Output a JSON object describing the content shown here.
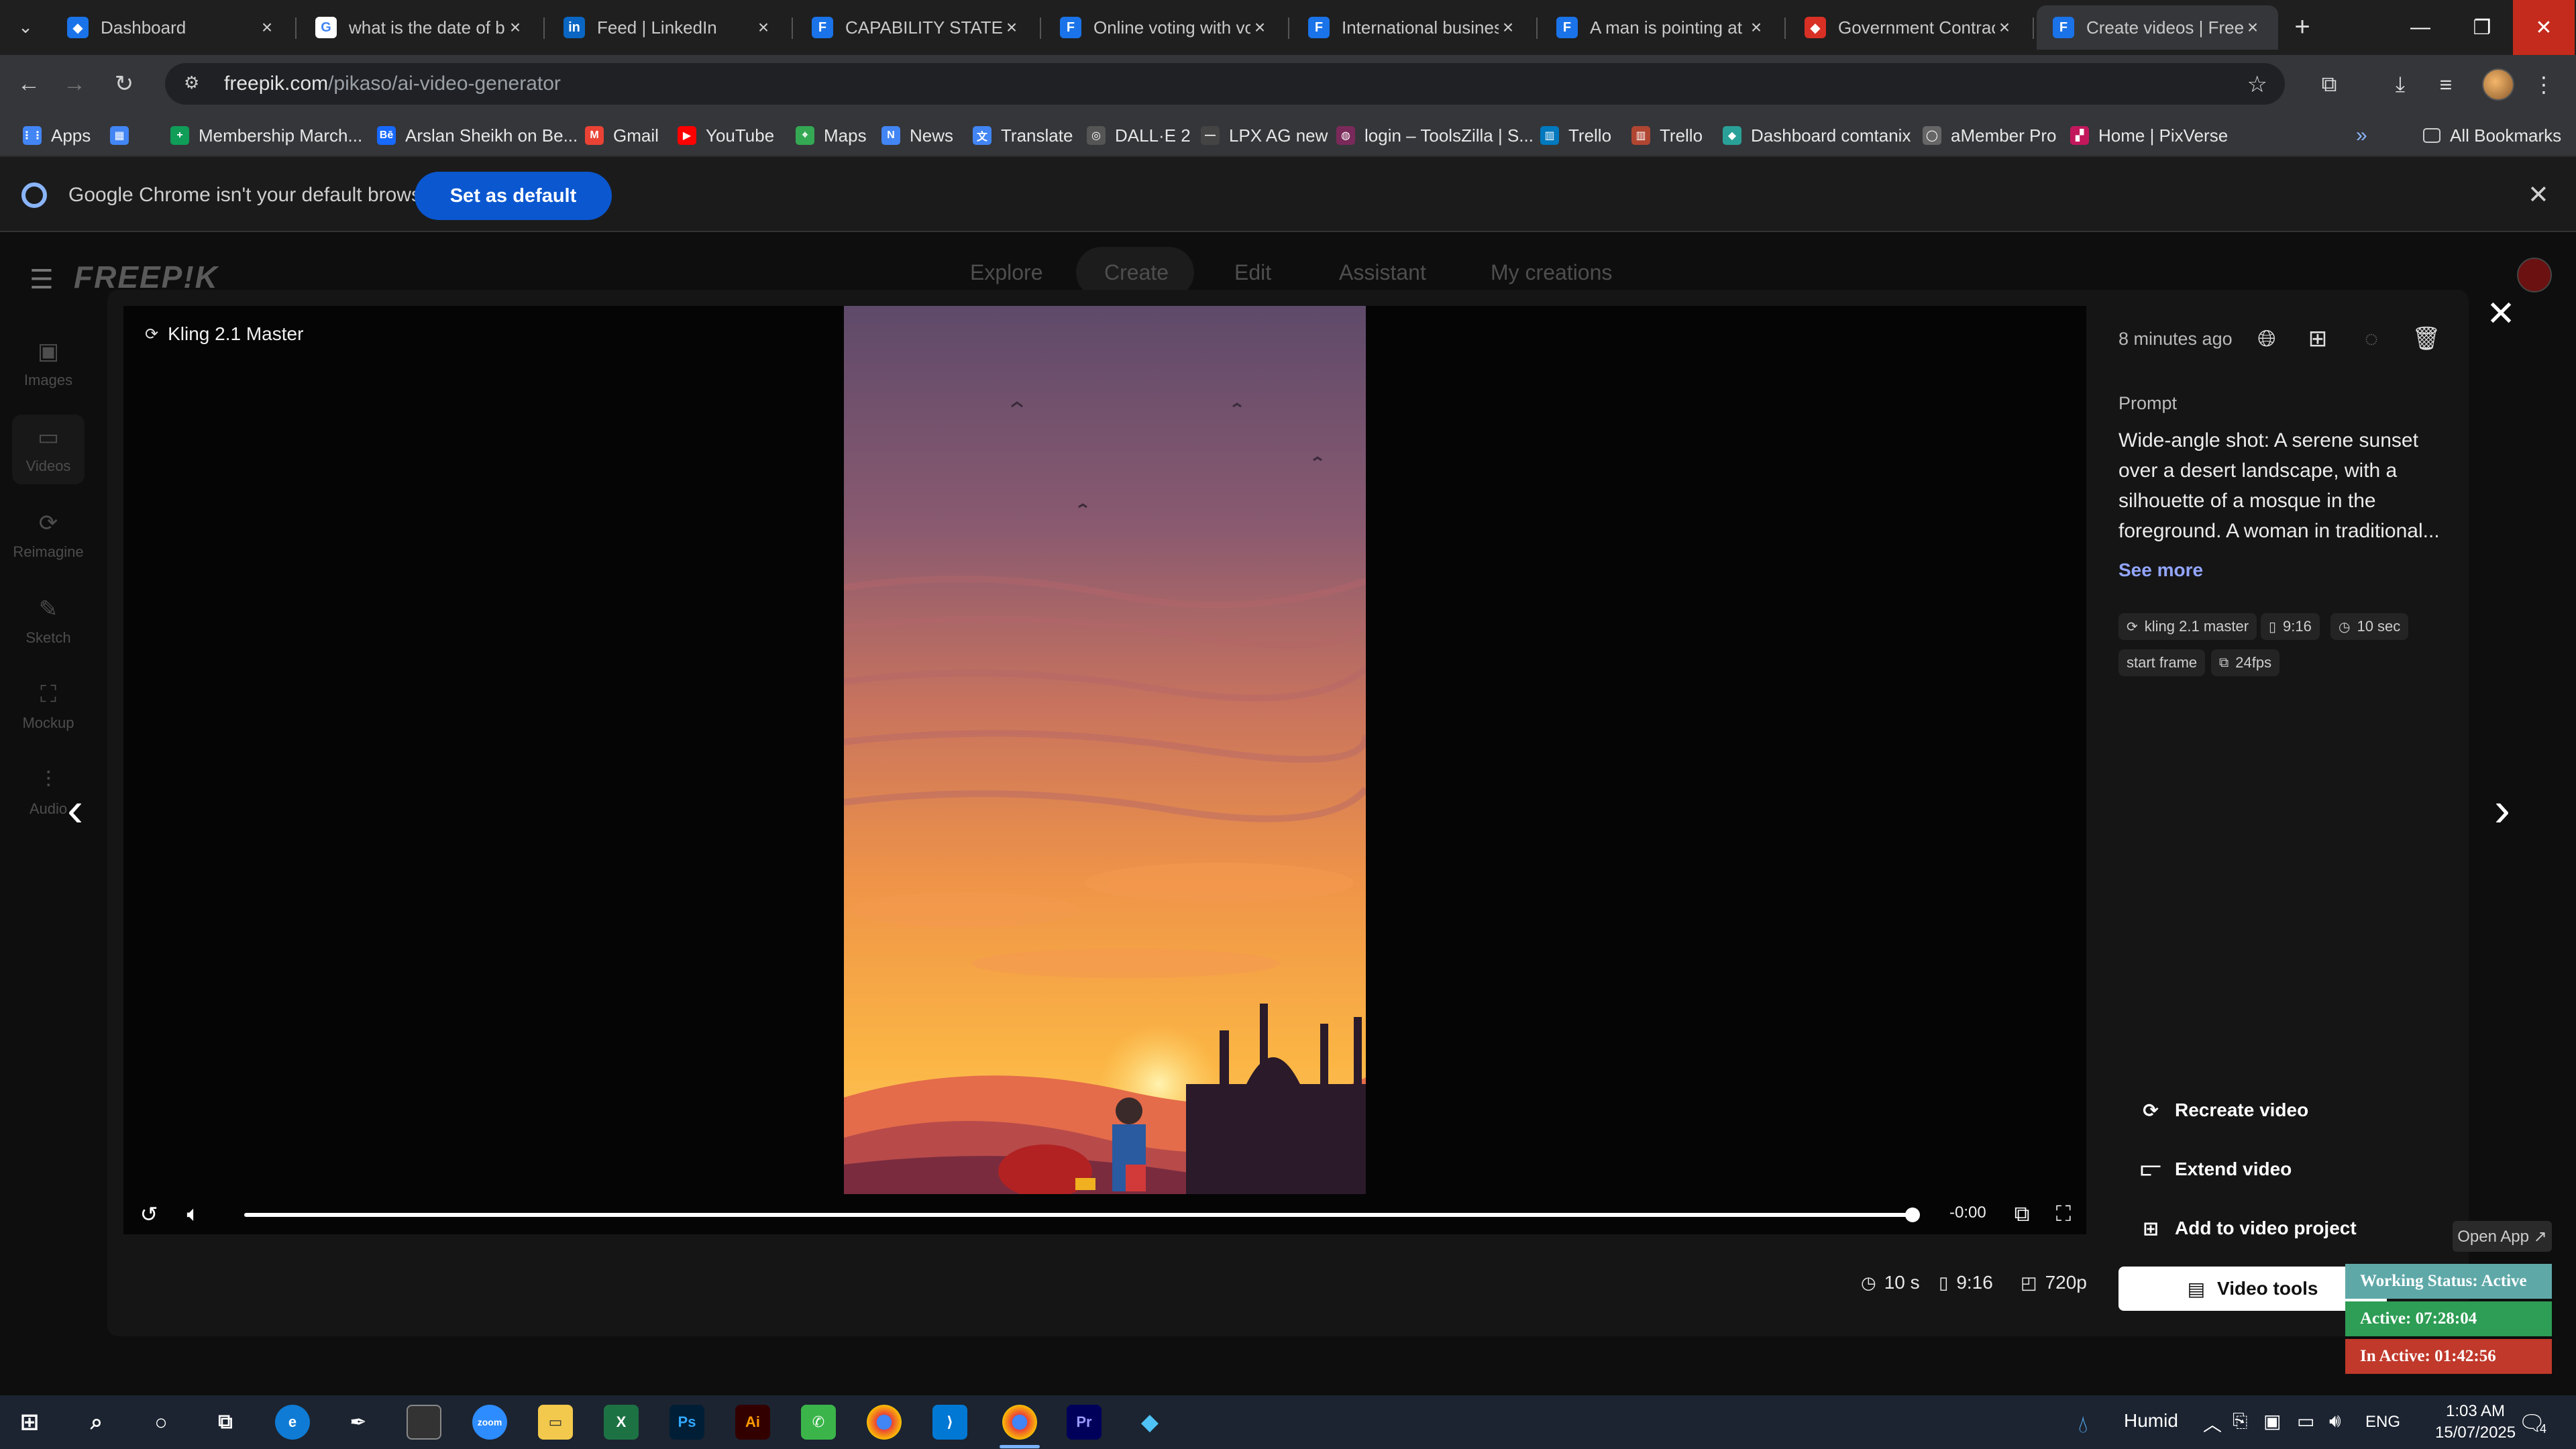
{
  "browser": {
    "tabs": [
      {
        "title": "Dashboard",
        "active": false,
        "color": "#1a73e8",
        "glyph": "◆"
      },
      {
        "title": "what is the date of bi",
        "active": false,
        "color": "#ffffff",
        "glyph": "G"
      },
      {
        "title": "Feed | LinkedIn",
        "active": false,
        "color": "#0a66c2",
        "glyph": "in"
      },
      {
        "title": "CAPABILITY STATEME",
        "active": false,
        "color": "#1a73e8",
        "glyph": "F"
      },
      {
        "title": "Online voting with vo",
        "active": false,
        "color": "#1a73e8",
        "glyph": "F"
      },
      {
        "title": "International busines",
        "active": false,
        "color": "#1a73e8",
        "glyph": "F"
      },
      {
        "title": "A man is pointing at",
        "active": false,
        "color": "#1a73e8",
        "glyph": "F"
      },
      {
        "title": "Government Contract",
        "active": false,
        "color": "#d93025",
        "glyph": "◆"
      },
      {
        "title": "Create videos | Freep",
        "active": true,
        "color": "#1a73e8",
        "glyph": "F"
      }
    ],
    "url_host": "freepik.com",
    "url_path": "/pikaso/ai-video-generator",
    "bookmarks": [
      {
        "label": "Apps",
        "color": "#4285f4",
        "glyph": "⋮⋮"
      },
      {
        "label": "",
        "color": "#4285f4",
        "glyph": "▦"
      },
      {
        "label": "Membership March...",
        "color": "#0f9d58",
        "glyph": "+"
      },
      {
        "label": "Arslan Sheikh on Be...",
        "color": "#1769ff",
        "glyph": "Bē"
      },
      {
        "label": "Gmail",
        "color": "#ea4335",
        "glyph": "M"
      },
      {
        "label": "YouTube",
        "color": "#ff0000",
        "glyph": "▶"
      },
      {
        "label": "Maps",
        "color": "#34a853",
        "glyph": "⌖"
      },
      {
        "label": "News",
        "color": "#4285f4",
        "glyph": "N"
      },
      {
        "label": "Translate",
        "color": "#4285f4",
        "glyph": "文"
      },
      {
        "label": "DALL·E 2",
        "color": "#555555",
        "glyph": "◎"
      },
      {
        "label": "LPX AG new",
        "color": "#444444",
        "glyph": "—"
      },
      {
        "label": "login – ToolsZilla | S...",
        "color": "#7a2a5a",
        "glyph": "◍"
      },
      {
        "label": "Trello",
        "color": "#0079bf",
        "glyph": "▥"
      },
      {
        "label": "Trello",
        "color": "#b04632",
        "glyph": "▥"
      },
      {
        "label": "Dashboard comtanix",
        "color": "#2aa198",
        "glyph": "◆"
      },
      {
        "label": "aMember Pro",
        "color": "#666666",
        "glyph": "◯"
      },
      {
        "label": "Home | PixVerse",
        "color": "#c2185b",
        "glyph": "▞"
      }
    ],
    "all_bookmarks": "All Bookmarks"
  },
  "infobar": {
    "message": "Google Chrome isn't your default browser",
    "button": "Set as default"
  },
  "freepik": {
    "logo": "FREEP!K",
    "nav": [
      "Explore",
      "Create",
      "Edit",
      "Assistant",
      "My creations"
    ],
    "sidebar": [
      "Images",
      "Videos",
      "Reimagine",
      "Sketch",
      "Mockup",
      "Audio"
    ]
  },
  "player": {
    "model": "Kling 2.1 Master",
    "time_remaining": "-0:00",
    "progress": 1.0
  },
  "info": {
    "ago": "8 minutes ago",
    "prompt_label": "Prompt",
    "prompt": "Wide-angle shot: A serene sunset over a desert landscape, with a silhouette of a mosque in the foreground. A woman in traditional...",
    "see_more": "See more",
    "chips": [
      {
        "icon": "⟳",
        "label": "kling 2.1 master"
      },
      {
        "icon": "▯",
        "label": "9:16"
      },
      {
        "icon": "◷",
        "label": "10 sec"
      },
      {
        "icon": "",
        "label": "start frame"
      },
      {
        "icon": "⧉",
        "label": "24fps"
      }
    ],
    "actions": [
      "Recreate video",
      "Extend video",
      "Add to video project"
    ],
    "video_tools": "Video tools"
  },
  "footer_meta": {
    "duration": "10 s",
    "ratio": "9:16",
    "resolution": "720p"
  },
  "tracker": {
    "open_app": "Open App ↗",
    "status": "Working Status: Active",
    "active": "Active: 07:28:04",
    "inactive": "In Active: 01:42:56",
    "colors": {
      "status": "#5fa8a8",
      "active": "#2e9d55",
      "inactive": "#c0392b"
    }
  },
  "taskbar": {
    "weather": "Humid",
    "lang": "ENG",
    "time": "1:03 AM",
    "date": "15/07/2025",
    "notifications": "4"
  }
}
